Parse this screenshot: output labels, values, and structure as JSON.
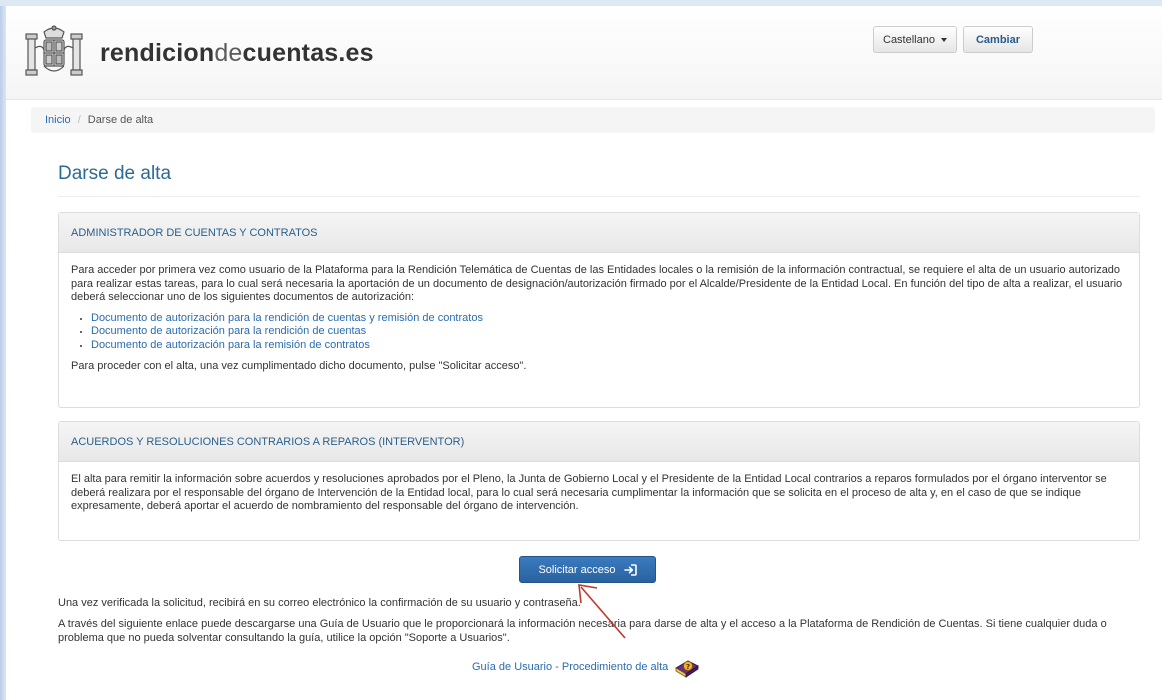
{
  "header": {
    "site_name_part1": "rendicion",
    "site_name_part2": "de",
    "site_name_part3": "cuentas.es",
    "language_selected": "Castellano",
    "change_button": "Cambiar"
  },
  "breadcrumb": {
    "home": "Inicio",
    "separator": "/",
    "current": "Darse de alta"
  },
  "page_title": "Darse de alta",
  "panel_admin": {
    "heading": "ADMINISTRADOR DE CUENTAS Y CONTRATOS",
    "intro": "Para acceder por primera vez como usuario de la Plataforma para la Rendición Telemática de Cuentas de las Entidades locales o la remisión de la información contractual, se requiere el alta de un usuario autorizado para realizar estas tareas, para lo cual será necesaria la aportación de un documento de designación/autorización firmado por el Alcalde/Presidente de la Entidad Local. En función del tipo de alta a realizar, el usuario deberá seleccionar uno de los siguientes documentos de autorización:",
    "links": [
      "Documento de autorización para la rendición de cuentas y remisión de contratos",
      "Documento de autorización para la rendición de cuentas",
      "Documento de autorización para la remisión de contratos"
    ],
    "closing": "Para proceder con el alta, una vez cumplimentado dicho documento, pulse \"Solicitar acceso\"."
  },
  "panel_acuerdos": {
    "heading": "ACUERDOS Y RESOLUCIONES CONTRARIOS A REPAROS (INTERVENTOR)",
    "body": "El alta para remitir la información sobre acuerdos y resoluciones aprobados por el Pleno, la Junta de Gobierno Local y el Presidente de la Entidad Local contrarios a reparos formulados por el órgano interventor se deberá realizara por el responsable del órgano de Intervención de la Entidad local, para lo cual será necesaria cumplimentar la información que se solicita en el proceso de alta y, en el caso de que se indique expresamente, deberá aportar el acuerdo de nombramiento del responsable del órgano de intervención."
  },
  "solicitar_button": "Solicitar acceso",
  "paragraph_verification": "Una vez verificada la solicitud, recibirá en su correo electrónico la confirmación de su usuario y contraseña.",
  "paragraph_guide": "A través del siguiente enlace puede descargarse una Guía de Usuario que le proporcionará la información necesaria para darse de alta y el acceso a la Plataforma de Rendición de Cuentas. Si tiene cualquier duda o problema que no pueda solventar consultando la guía, utilice la opción \"Soporte a Usuarios\".",
  "guide_link": "Guía de Usuario - Procedimiento de alta",
  "icons": {
    "crest": "spain-coat-of-arms-icon",
    "caret": "caret-down-icon",
    "login": "sign-in-icon",
    "book": "help-book-icon",
    "annotation": "red-arrow-icon"
  },
  "colors": {
    "primary": "#2a6cb0",
    "title": "#2c6a96",
    "arrow": "#c0392b"
  }
}
